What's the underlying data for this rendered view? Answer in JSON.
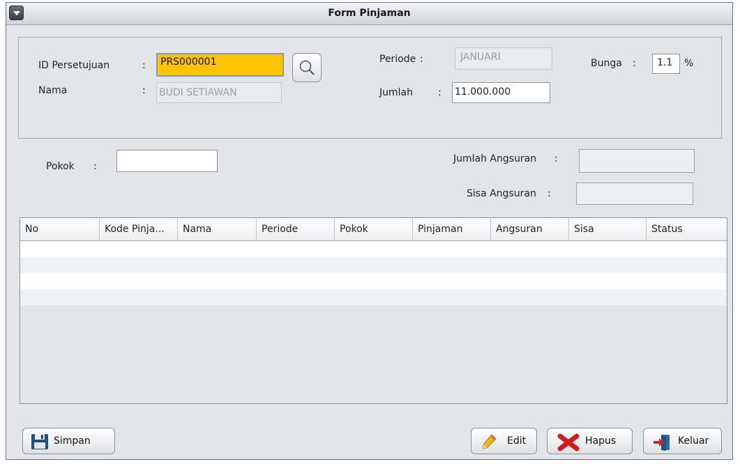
{
  "window": {
    "title": "Form Pinjaman"
  },
  "form": {
    "id_persetujuan": {
      "label": "ID Persetujuan",
      "colon": ":",
      "value": "PRS000001"
    },
    "nama": {
      "label": "Nama",
      "colon": ":",
      "value": "BUDI SETIAWAN"
    },
    "periode": {
      "label": "Periode",
      "colon": ":",
      "value": "JANUARI"
    },
    "jumlah": {
      "label": "Jumlah",
      "colon": ":",
      "value": "11.000.000"
    },
    "bunga": {
      "label": "Bunga",
      "colon": ":",
      "value": "1.1",
      "unit": "%"
    },
    "pokok": {
      "label": "Pokok",
      "colon": ":",
      "value": ""
    },
    "jumlah_angsuran": {
      "label": "Jumlah Angsuran",
      "colon": ":",
      "value": ""
    },
    "sisa_angsuran": {
      "label": "Sisa Angsuran",
      "colon": ":",
      "value": ""
    }
  },
  "table": {
    "columns": [
      "No",
      "Kode Pinja...",
      "Nama",
      "Periode",
      "Pokok",
      "Pinjaman",
      "Angsuran",
      "Sisa",
      "Status"
    ],
    "rows": []
  },
  "buttons": {
    "simpan": "Simpan",
    "edit": "Edit",
    "hapus": "Hapus",
    "keluar": "Keluar"
  },
  "icons": {
    "search": "search-icon",
    "save": "floppy-disk-icon",
    "edit": "pencil-icon",
    "delete": "red-x-icon",
    "exit": "exit-door-icon"
  }
}
